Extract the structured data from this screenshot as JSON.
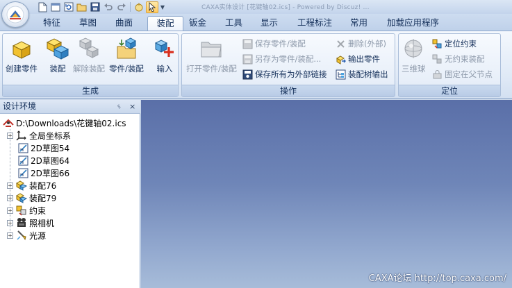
{
  "window": {
    "title": "CAXA实体设计 [花键轴02.ics] - Powered by Discuz! ...",
    "app_button_icon": "caxa-logo-icon"
  },
  "quick_access": {
    "items": [
      "new-document-icon",
      "new-window-icon",
      "reload-icon",
      "open-folder-icon",
      "save-icon",
      "undo-icon",
      "redo-icon",
      "smart-icon",
      "pointer-select-icon",
      "dropdown-icon"
    ]
  },
  "ribbon": {
    "tabs": [
      {
        "label": "特征"
      },
      {
        "label": "草图"
      },
      {
        "label": "曲面"
      },
      {
        "label": "装配"
      },
      {
        "label": "钣金"
      },
      {
        "label": "工具"
      },
      {
        "label": "显示"
      },
      {
        "label": "工程标注"
      },
      {
        "label": "常用"
      },
      {
        "label": "加载应用程序"
      }
    ],
    "active_tab": "装配",
    "groups": {
      "generate": {
        "label": "生成",
        "buttons": [
          {
            "label": "创建零件",
            "enabled": true
          },
          {
            "label": "装配",
            "enabled": true
          },
          {
            "label": "解除装配",
            "enabled": false
          },
          {
            "label": "零件/装配",
            "enabled": true
          },
          {
            "label": "输入",
            "enabled": true
          }
        ]
      },
      "operate": {
        "label": "操作",
        "big_button": {
          "label": "打开零件/装配",
          "enabled": false
        },
        "small_buttons": [
          {
            "label": "保存零件/装配",
            "enabled": false
          },
          {
            "label": "另存为零件/装配...",
            "enabled": false
          },
          {
            "label": "保存所有为外部链接",
            "enabled": true
          },
          {
            "label": "删除(外部)",
            "enabled": false
          },
          {
            "label": "输出零件",
            "enabled": true
          },
          {
            "label": "装配树输出",
            "enabled": true
          }
        ]
      },
      "position": {
        "label": "定位",
        "big_button": {
          "label": "三维球",
          "enabled": false
        },
        "small_buttons": [
          {
            "label": "定位约束",
            "enabled": true
          },
          {
            "label": "无约束装配",
            "enabled": false
          },
          {
            "label": "固定在父节点",
            "enabled": false
          }
        ]
      }
    }
  },
  "design_panel": {
    "title": "设计环境",
    "pin_glyph": "ᛃ",
    "close_glyph": "×",
    "root": "D:\\Downloads\\花键轴02.ics",
    "nodes": [
      {
        "label": "全局坐标系",
        "expandable": true
      },
      {
        "label": "2D草图54",
        "expandable": false
      },
      {
        "label": "2D草图64",
        "expandable": false
      },
      {
        "label": "2D草图66",
        "expandable": false
      },
      {
        "label": "装配76",
        "expandable": true
      },
      {
        "label": "装配79",
        "expandable": true
      },
      {
        "label": "约束",
        "expandable": true
      },
      {
        "label": "照相机",
        "expandable": true
      },
      {
        "label": "光源",
        "expandable": true
      }
    ]
  },
  "viewport": {
    "watermark": "CAXA论坛 http://top.caxa.com/"
  }
}
